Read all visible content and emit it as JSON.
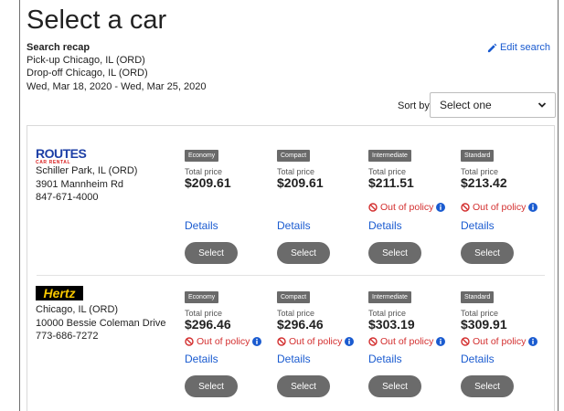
{
  "page": {
    "title": "Select a car"
  },
  "recap": {
    "heading": "Search recap",
    "pickup": "Pick-up Chicago, IL (ORD)",
    "dropoff": "Drop-off Chicago, IL (ORD)",
    "dates": "Wed, Mar 18, 2020 - Wed, Mar 25, 2020",
    "edit_label": "Edit search"
  },
  "sort": {
    "label": "Sort by",
    "selected": "Select one"
  },
  "colors": {
    "link": "#1a5bd0",
    "out_of_policy": "#d32f2f",
    "button": "#6b6b6b",
    "badge": "#6a6a6a"
  },
  "common": {
    "total_label": "Total price",
    "details_label": "Details",
    "select_label": "Select",
    "out_of_policy_label": "Out of policy"
  },
  "vendors": [
    {
      "logo_text": "ROUTES",
      "logo_subtext": "CAR RENTAL",
      "location": "Schiller Park, IL (ORD)",
      "address": "3901 Mannheim Rd",
      "phone": "847-671-4000",
      "offers": [
        {
          "category": "Economy",
          "price": "$209.61",
          "out_of_policy": false
        },
        {
          "category": "Compact",
          "price": "$209.61",
          "out_of_policy": false
        },
        {
          "category": "Intermediate",
          "price": "$211.51",
          "out_of_policy": true
        },
        {
          "category": "Standard",
          "price": "$213.42",
          "out_of_policy": true
        }
      ]
    },
    {
      "logo_text": "Hertz",
      "location": "Chicago, IL (ORD)",
      "address": "10000 Bessie Coleman Drive",
      "phone": "773-686-7272",
      "offers": [
        {
          "category": "Economy",
          "price": "$296.46",
          "out_of_policy": true
        },
        {
          "category": "Compact",
          "price": "$296.46",
          "out_of_policy": true
        },
        {
          "category": "Intermediate",
          "price": "$303.19",
          "out_of_policy": true
        },
        {
          "category": "Standard",
          "price": "$309.91",
          "out_of_policy": true
        }
      ]
    }
  ]
}
